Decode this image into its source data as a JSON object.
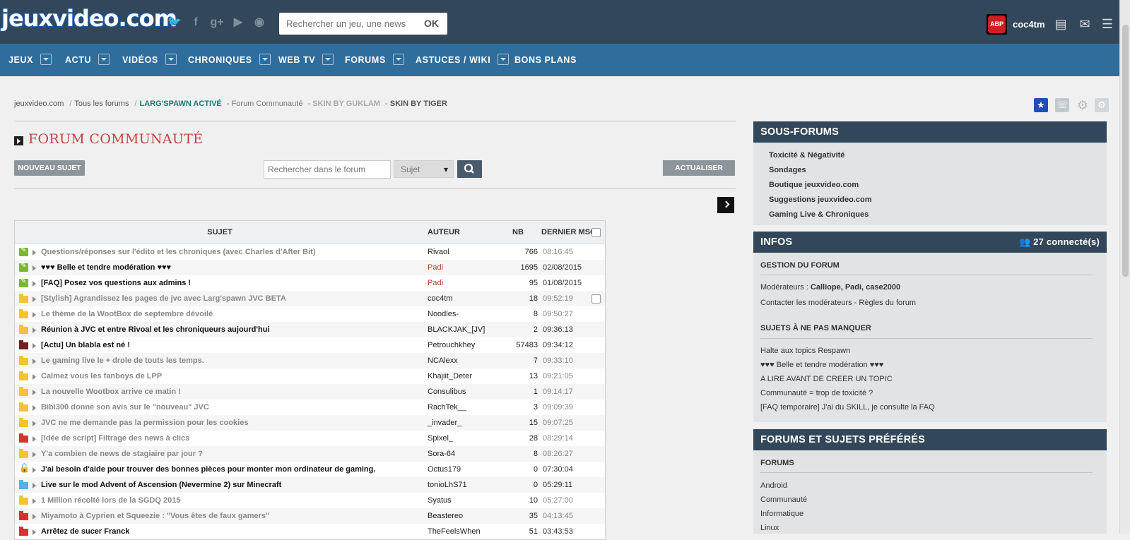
{
  "header": {
    "logo": "jeuxvideo.com",
    "search_placeholder": "Rechercher un jeu, une news",
    "search_button": "OK",
    "abp": "ABP",
    "username": "coc4tm",
    "social_icons": [
      "twitter-icon",
      "facebook-icon",
      "googleplus-icon",
      "youtube-icon",
      "rss-icon"
    ]
  },
  "nav": [
    {
      "label": "JEUX",
      "dropdown": true
    },
    {
      "label": "ACTU",
      "dropdown": true
    },
    {
      "label": "VIDÉOS",
      "dropdown": true
    },
    {
      "label": "CHRONIQUES",
      "dropdown": true
    },
    {
      "label": "WEB TV",
      "dropdown": true
    },
    {
      "label": "FORUMS",
      "dropdown": true
    },
    {
      "label": "ASTUCES / WIKI",
      "dropdown": true
    },
    {
      "label": "BONS PLANS",
      "dropdown": false
    }
  ],
  "breadcrumb": {
    "home": "jeuxvideo.com",
    "sep": "/",
    "all_forums": "Tous les forums",
    "larg": "LARG'SPAWN ACTIVÉ",
    "dash1": " - ",
    "forum": "Forum Communauté",
    "dash2": " - ",
    "guklam": "SKIN BY GUKLAM",
    "dash3": " - ",
    "tiger": "SKIN BY TIGER"
  },
  "forum": {
    "title": "FORUM COMMUNAUTÉ",
    "new_topic": "NOUVEAU SUJET",
    "search_placeholder": "Rechercher dans le forum",
    "search_select": "Sujet",
    "refresh": "ACTUALISER"
  },
  "table": {
    "headers": {
      "subject": "SUJET",
      "author": "AUTEUR",
      "nb": "NB",
      "last": "DERNIER MSG"
    },
    "rows": [
      {
        "icon": "pin",
        "subject": "Questions/réponses sur l'édito et les chroniques (avec Charles d'After Bit)",
        "author": "Rivaol",
        "nb": "766",
        "last": "08:16:45",
        "read": true,
        "mod": false
      },
      {
        "icon": "pin",
        "subject": "♥♥♥ Belle et tendre modération ♥♥♥",
        "author": "Padi",
        "nb": "1695",
        "last": "02/08/2015",
        "read": false,
        "mod": true
      },
      {
        "icon": "pin",
        "subject": "[FAQ] Posez vos questions aux admins !",
        "author": "Padi",
        "nb": "95",
        "last": "01/08/2015",
        "read": false,
        "mod": true
      },
      {
        "icon": "folder",
        "subject": "[Stylish] Agrandissez les pages de jvc avec Larg'spawn JVC BETA",
        "author": "coc4tm",
        "nb": "18",
        "last": "09:52:19",
        "read": true,
        "mod": false,
        "check": true
      },
      {
        "icon": "folder",
        "subject": "Le thème de la WootBox de septembre dévoilé",
        "author": "Noodles-",
        "nb": "8",
        "last": "09:50:27",
        "read": true,
        "mod": false
      },
      {
        "icon": "folder",
        "subject": "Réunion à JVC et entre Rivoal et les chroniqueurs aujourd'hui",
        "author": "BLACKJAK_[JV]",
        "nb": "2",
        "last": "09:36:13",
        "read": false,
        "mod": false
      },
      {
        "icon": "folder-dark",
        "subject": "[Actu] Un blabla est né !",
        "author": "Petrouchkhey",
        "nb": "57483",
        "last": "09:34:12",
        "read": false,
        "mod": false
      },
      {
        "icon": "folder",
        "subject": "Le gaming live le + drole de touts les temps.",
        "author": "NCAlexx",
        "nb": "7",
        "last": "09:33:10",
        "read": true,
        "mod": false
      },
      {
        "icon": "folder",
        "subject": "Calmez vous les fanboys de LPP",
        "author": "Khajiit_Deter",
        "nb": "13",
        "last": "09:21:05",
        "read": true,
        "mod": false
      },
      {
        "icon": "folder",
        "subject": "La nouvelle Wootbox arrive ce matin !",
        "author": "Consulibus",
        "nb": "1",
        "last": "09:14:17",
        "read": true,
        "mod": false
      },
      {
        "icon": "folder",
        "subject": "Bibi300 donne son avis sur le \"nouveau\" JVC",
        "author": "RachTek__",
        "nb": "3",
        "last": "09:09:39",
        "read": true,
        "mod": false
      },
      {
        "icon": "folder",
        "subject": "JVC ne me demande pas la permission pour les cookies",
        "author": "_invader_",
        "nb": "15",
        "last": "09:07:25",
        "read": true,
        "mod": false
      },
      {
        "icon": "folder-red",
        "subject": "[Idée de script] Filtrage des news à clics",
        "author": "Spixel_",
        "nb": "28",
        "last": "08:29:14",
        "read": true,
        "mod": false
      },
      {
        "icon": "folder",
        "subject": "Y'a combien de news de stagiaire par jour ?",
        "author": "Sora-64",
        "nb": "8",
        "last": "08:26:27",
        "read": true,
        "mod": false
      },
      {
        "icon": "lock",
        "subject": "J'ai besoin d'aide pour trouver des bonnes pièces pour monter mon ordinateur de gaming.",
        "author": "Octus179",
        "nb": "0",
        "last": "07:30:04",
        "read": false,
        "mod": false
      },
      {
        "icon": "folder-blue",
        "subject": "Live sur le mod Advent of Ascension (Nevermine 2) sur Minecraft",
        "author": "tonioLhS71",
        "nb": "0",
        "last": "05:29:11",
        "read": false,
        "mod": false
      },
      {
        "icon": "folder",
        "subject": "1 Million récolté lors de la SGDQ 2015",
        "author": "Syatus",
        "nb": "10",
        "last": "05:27:00",
        "read": true,
        "mod": false
      },
      {
        "icon": "folder-red",
        "subject": "Miyamoto à Cyprien et Squeezie : \"Vous êtes de faux gamers\"",
        "author": "Beastereo",
        "nb": "35",
        "last": "04:13:45",
        "read": true,
        "mod": false
      },
      {
        "icon": "folder-red",
        "subject": "Arrêtez de sucer Franck",
        "author": "TheFeelsWhen",
        "nb": "51",
        "last": "03:43:53",
        "read": false,
        "mod": false
      }
    ]
  },
  "sidebar": {
    "subforums": {
      "title": "SOUS-FORUMS",
      "items": [
        "Toxicité & Négativité",
        "Sondages",
        "Boutique jeuxvideo.com",
        "Suggestions jeuxvideo.com",
        "Gaming Live & Chroniques"
      ]
    },
    "infos": {
      "title": "INFOS",
      "connected": "27 connecté(s)",
      "gestion_title": "GESTION DU FORUM",
      "mods_label": "Modérateurs : ",
      "mods": "Calliope, Padi, case2000",
      "contact": "Contacter les modérateurs - Règles du forum",
      "must_title": "SUJETS À NE PAS MANQUER",
      "must": [
        "Halte aux topics Respawn",
        "♥♥♥ Belle et tendre modération ♥♥♥",
        "A LIRE AVANT DE CREER UN TOPIC",
        "Communauté = trop de toxicité ?",
        "[FAQ temporaire] J'ai du SKILL, je consulte la FAQ"
      ]
    },
    "favorites": {
      "title": "FORUMS ET SUJETS PRÉFÉRÉS",
      "forums_title": "FORUMS",
      "forums": [
        "Android",
        "Communauté",
        "Informatique",
        "Linux"
      ]
    }
  }
}
